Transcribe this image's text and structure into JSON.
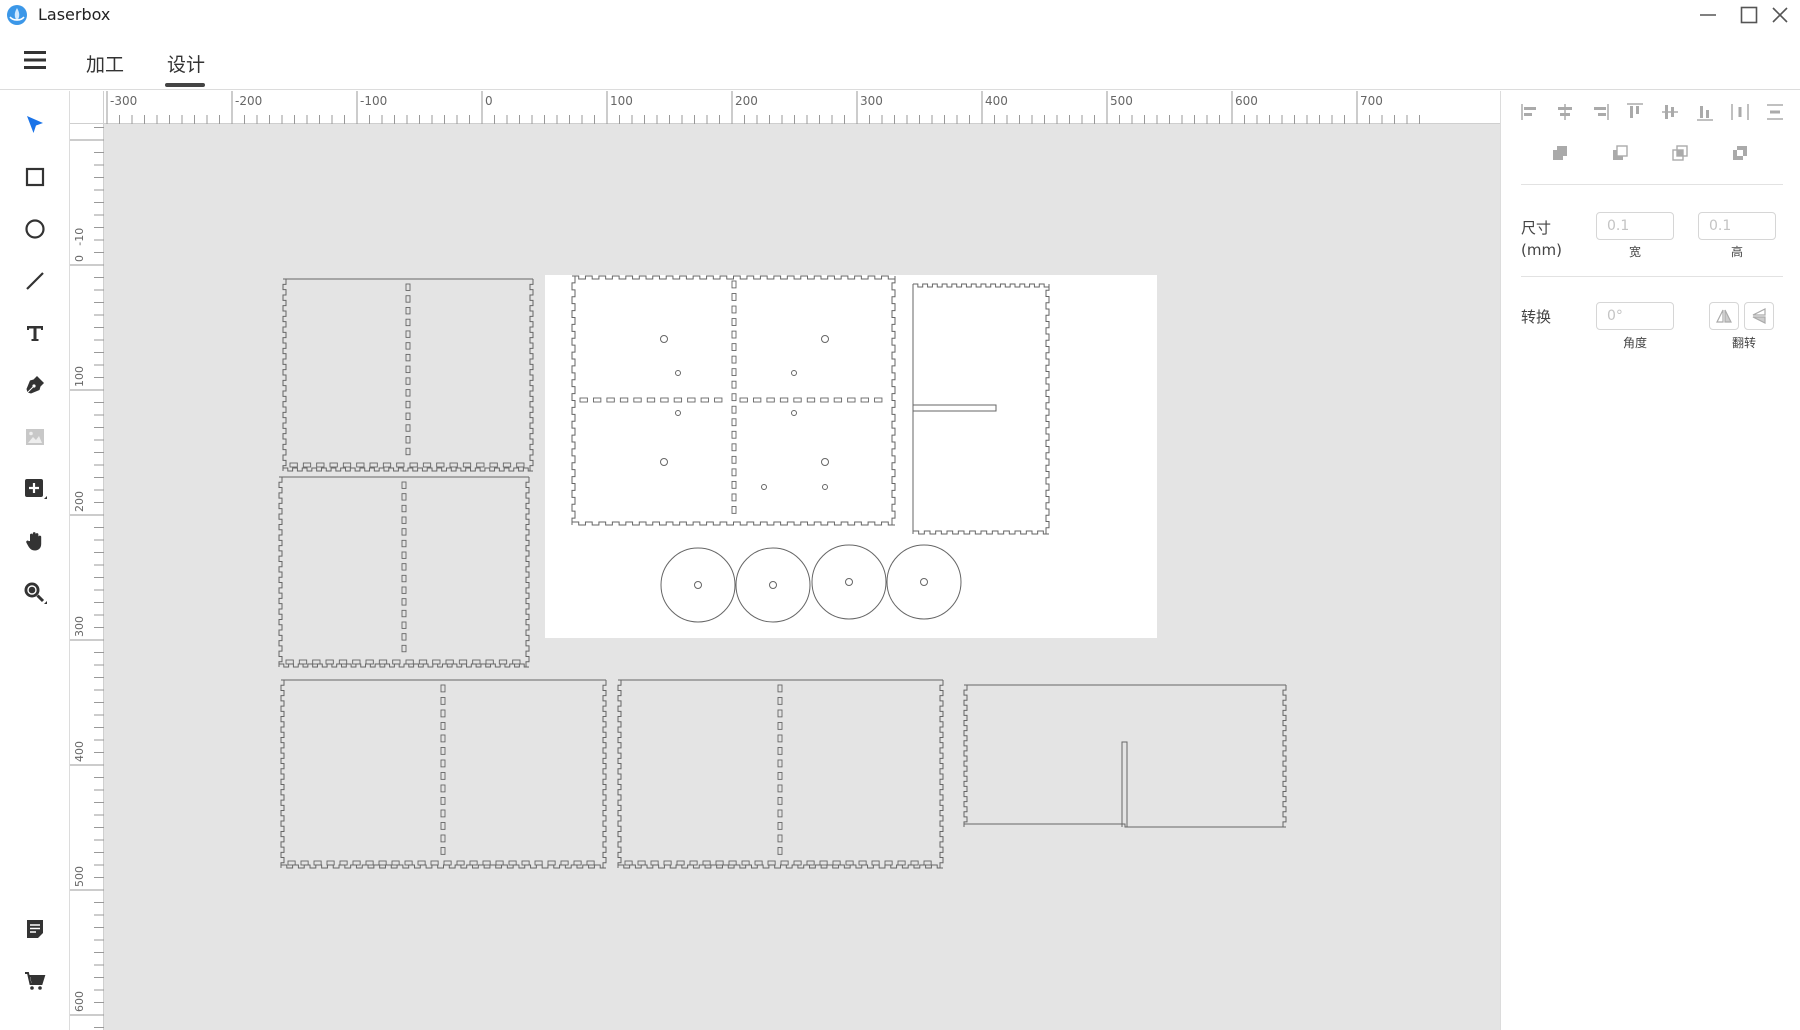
{
  "app": {
    "title": "Laserbox"
  },
  "menu": {
    "tabs": [
      {
        "label": "加工",
        "active": false
      },
      {
        "label": "设计",
        "active": true
      }
    ]
  },
  "tools": [
    {
      "name": "select",
      "icon": "arrow-pointer-icon",
      "active": true
    },
    {
      "name": "rectangle",
      "icon": "square-icon"
    },
    {
      "name": "ellipse",
      "icon": "circle-icon"
    },
    {
      "name": "line",
      "icon": "line-icon"
    },
    {
      "name": "text",
      "icon": "text-icon"
    },
    {
      "name": "pen",
      "icon": "pen-icon"
    },
    {
      "name": "image",
      "icon": "image-icon",
      "disabled": true
    },
    {
      "name": "add-shape",
      "icon": "add-box-icon"
    },
    {
      "name": "pan",
      "icon": "hand-icon"
    },
    {
      "name": "zoom",
      "icon": "zoom-icon"
    },
    {
      "name": "notes",
      "icon": "document-icon"
    },
    {
      "name": "store",
      "icon": "cart-icon"
    }
  ],
  "rulers": {
    "top_labels": [
      "-300",
      "-200",
      "-100",
      "0",
      "100",
      "200",
      "300",
      "400",
      "500",
      "600",
      "700"
    ],
    "left_labels": [
      "-10",
      "0",
      "100",
      "200",
      "300",
      "400",
      "500",
      "600"
    ]
  },
  "properties": {
    "size_label_line1": "尺寸",
    "size_label_line2": "(mm)",
    "width_placeholder": "0.1",
    "height_placeholder": "0.1",
    "width_caption": "宽",
    "height_caption": "高",
    "transform_label": "转换",
    "angle_placeholder": "0°",
    "angle_caption": "角度",
    "flip_caption": "翻转"
  },
  "colors": {
    "accent": "#1a73e8",
    "canvas_bg": "#e4e4e4",
    "part_stroke": "#666666"
  }
}
